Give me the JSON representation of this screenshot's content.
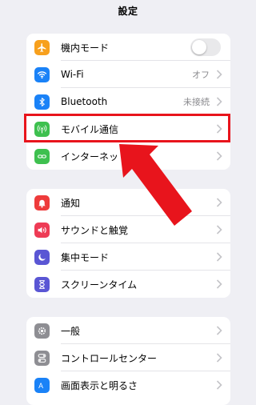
{
  "header": {
    "title": "設定"
  },
  "group1": {
    "items": [
      {
        "label": "機内モード",
        "icon": "airplane-icon",
        "color": "#f7a01d",
        "control": "toggle",
        "toggle_on": false
      },
      {
        "label": "Wi-Fi",
        "icon": "wifi-icon",
        "color": "#1a82f7",
        "value": "オフ"
      },
      {
        "label": "Bluetooth",
        "icon": "bluetooth-icon",
        "color": "#1a82f7",
        "value": "未接続"
      },
      {
        "label": "モバイル通信",
        "icon": "antenna-icon",
        "color": "#3ec04f"
      },
      {
        "label": "インターネット共有",
        "icon": "personal-hotspot-icon",
        "color": "#3ec04f"
      }
    ]
  },
  "group2": {
    "items": [
      {
        "label": "通知",
        "icon": "notification-bell-icon",
        "color": "#ee3b3b"
      },
      {
        "label": "サウンドと触覚",
        "icon": "speaker-icon",
        "color": "#ee3b55"
      },
      {
        "label": "集中モード",
        "icon": "moon-icon",
        "color": "#5a56d4"
      },
      {
        "label": "スクリーンタイム",
        "icon": "hourglass-icon",
        "color": "#5a56d4"
      }
    ]
  },
  "group3": {
    "items": [
      {
        "label": "一般",
        "icon": "gear-icon",
        "color": "#8e8e93"
      },
      {
        "label": "コントロールセンター",
        "icon": "switches-icon",
        "color": "#8e8e93"
      },
      {
        "label": "画面表示と明るさ",
        "icon": "display-brightness-icon",
        "color": "#1a82f7"
      }
    ]
  },
  "annotation": {
    "highlight_color": "#e8141c",
    "target": "モバイル通信"
  }
}
